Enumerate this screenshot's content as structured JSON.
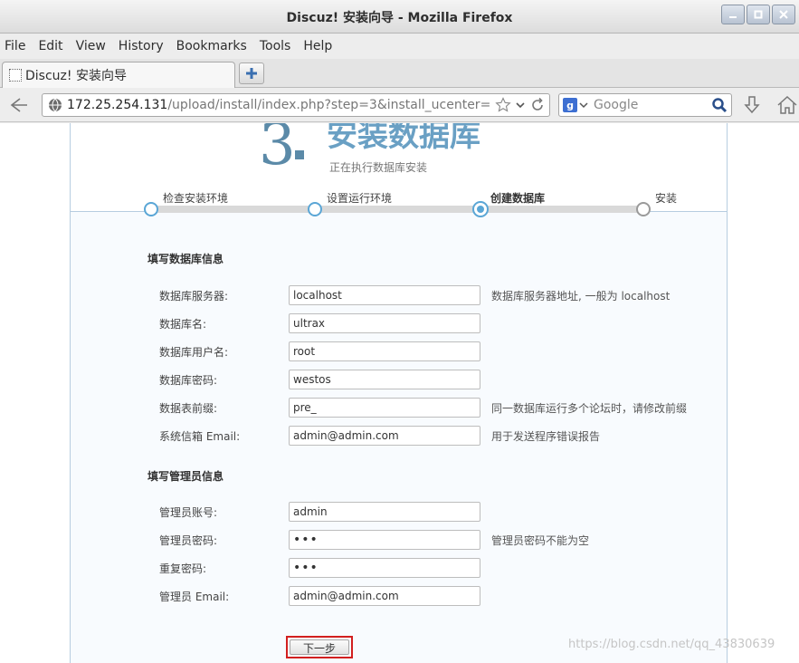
{
  "window": {
    "title": "Discuz! 安装向导 - Mozilla Firefox",
    "controls": [
      "minimize",
      "maximize",
      "close"
    ]
  },
  "menubar": {
    "items": [
      "File",
      "Edit",
      "View",
      "History",
      "Bookmarks",
      "Tools",
      "Help"
    ]
  },
  "tab": {
    "label": "Discuz! 安装向导"
  },
  "navbar": {
    "url_host": "172.25.254.131",
    "url_path": "/upload/install/index.php?step=3&install_ucenter=",
    "search_placeholder": "Google"
  },
  "header": {
    "step_number": "3",
    "title": "安装数据库",
    "subtitle": "正在执行数据库安装"
  },
  "steps": [
    {
      "label": "检查安装环境",
      "state": "done"
    },
    {
      "label": "设置运行环境",
      "state": "done"
    },
    {
      "label": "创建数据库",
      "state": "current"
    },
    {
      "label": "安装",
      "state": "pending"
    }
  ],
  "db_section": {
    "title": "填写数据库信息",
    "fields": [
      {
        "label": "数据库服务器:",
        "value": "localhost",
        "hint": "数据库服务器地址, 一般为 localhost"
      },
      {
        "label": "数据库名:",
        "value": "ultrax",
        "hint": ""
      },
      {
        "label": "数据库用户名:",
        "value": "root",
        "hint": ""
      },
      {
        "label": "数据库密码:",
        "value": "westos",
        "hint": ""
      },
      {
        "label": "数据表前缀:",
        "value": "pre_",
        "hint": "同一数据库运行多个论坛时，请修改前缀"
      },
      {
        "label": "系统信箱 Email:",
        "value": "admin@admin.com",
        "hint": "用于发送程序错误报告"
      }
    ]
  },
  "admin_section": {
    "title": "填写管理员信息",
    "fields": [
      {
        "label": "管理员账号:",
        "value": "admin",
        "hint": ""
      },
      {
        "label": "管理员密码:",
        "value": "•••",
        "hint": "管理员密码不能为空"
      },
      {
        "label": "重复密码:",
        "value": "•••",
        "hint": ""
      },
      {
        "label": "管理员 Email:",
        "value": "admin@admin.com",
        "hint": ""
      }
    ]
  },
  "actions": {
    "next_label": "下一步"
  },
  "watermark": "https://blog.csdn.net/qq_43830639",
  "colors": {
    "accent": "#5aa6d6",
    "heading": "#6aa0c4",
    "highlight_border": "#d21f1f"
  }
}
